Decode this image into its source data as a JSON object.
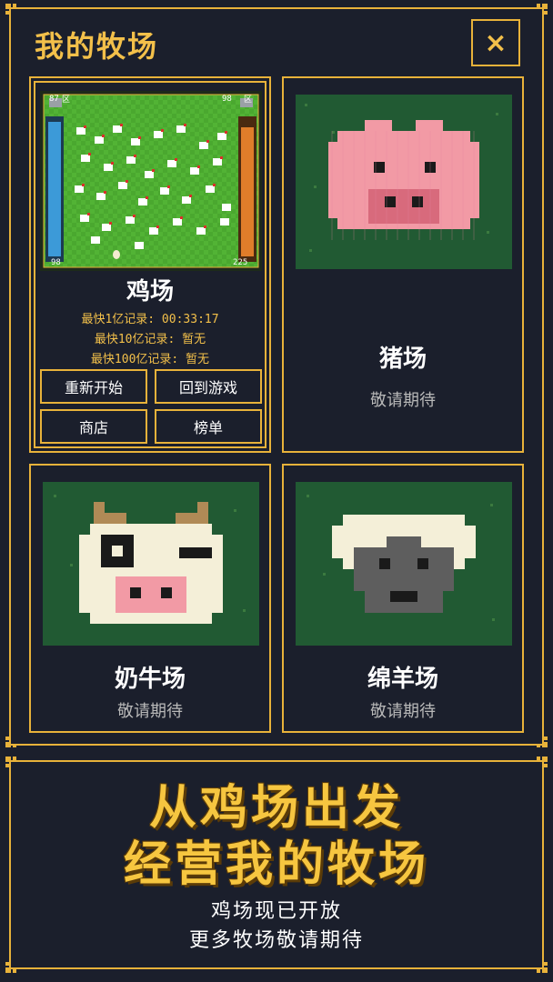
{
  "header": {
    "title": "我的牧场",
    "close_label": "×"
  },
  "colors": {
    "gold": "#e8b23a",
    "background": "#1b1f2c",
    "grass": "#215a33",
    "blue_bar": "#3c9ad8",
    "orange_bar": "#e07d2a"
  },
  "chicken_farm": {
    "name": "鸡场",
    "records": [
      "最快1亿记录: 00:33:17",
      "最快10亿记录: 暂无",
      "最快100亿记录: 暂无"
    ],
    "buttons": {
      "restart": "重新开始",
      "return": "回到游戏",
      "shop": "商店",
      "leaderboard": "榜单"
    },
    "preview": {
      "left_zone": "区",
      "right_zone": "区",
      "left_count": "98",
      "right_count": "225",
      "left_top": "87",
      "right_top": "98"
    }
  },
  "pig_farm": {
    "name": "猪场",
    "status": "敬请期待"
  },
  "cow_farm": {
    "name": "奶牛场",
    "status": "敬请期待"
  },
  "sheep_farm": {
    "name": "绵羊场",
    "status": "敬请期待"
  },
  "banner": {
    "line1": "从鸡场出发",
    "line2": "经营我的牧场",
    "sub1": "鸡场现已开放",
    "sub2": "更多牧场敬请期待"
  }
}
